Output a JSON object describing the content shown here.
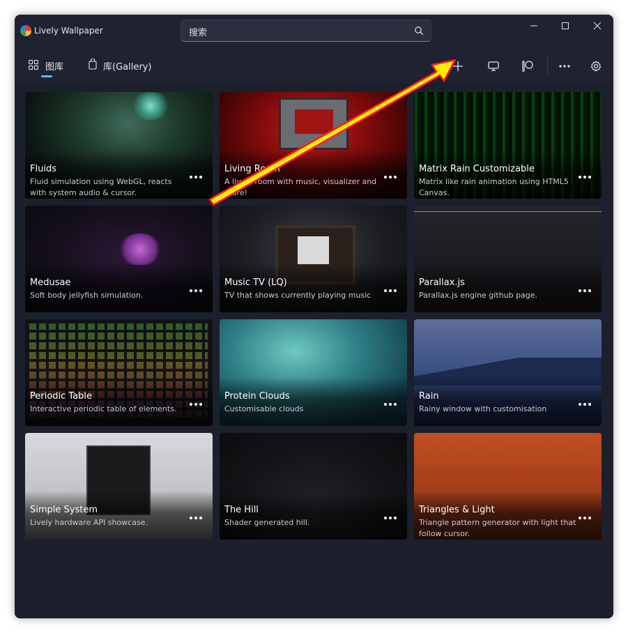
{
  "app": {
    "title": "Lively Wallpaper"
  },
  "search": {
    "text": "搜索"
  },
  "tabs": [
    {
      "label": "图库",
      "icon": "grid-icon",
      "selected": true
    },
    {
      "label": "库(Gallery)",
      "icon": "bag-icon",
      "selected": false
    }
  ],
  "toolbar": {
    "icons": [
      "add-icon",
      "monitor-icon",
      "patreon-icon",
      "more-icon",
      "settings-icon"
    ]
  },
  "colors": {
    "accent": "#4cc2ff",
    "annotation_arrow": "#ffee00",
    "annotation_outline": "#ff1a1a"
  },
  "wallpapers": [
    {
      "title": "Fluids",
      "description": "Fluid simulation using WebGL, reacts with system audio & cursor."
    },
    {
      "title": "Living Room",
      "description": "A lively room with music, visualizer and more!"
    },
    {
      "title": "Matrix Rain Customizable",
      "description": "Matrix like rain animation using HTML5 Canvas."
    },
    {
      "title": "Medusae",
      "description": "Soft body jellyfish simulation."
    },
    {
      "title": "Music TV (LQ)",
      "description": "TV that shows currently playing music"
    },
    {
      "title": "Parallax.js",
      "description": "Parallax.js engine github page."
    },
    {
      "title": "Periodic Table",
      "description": "Interactive periodic table of elements."
    },
    {
      "title": "Protein Clouds",
      "description": "Customisable clouds"
    },
    {
      "title": "Rain",
      "description": "Rainy window with customisation"
    },
    {
      "title": "Simple System",
      "description": "Lively hardware API showcase."
    },
    {
      "title": "The Hill",
      "description": "Shader generated hill."
    },
    {
      "title": "Triangles & Light",
      "description": "Triangle pattern generator with light that follow cursor."
    }
  ]
}
